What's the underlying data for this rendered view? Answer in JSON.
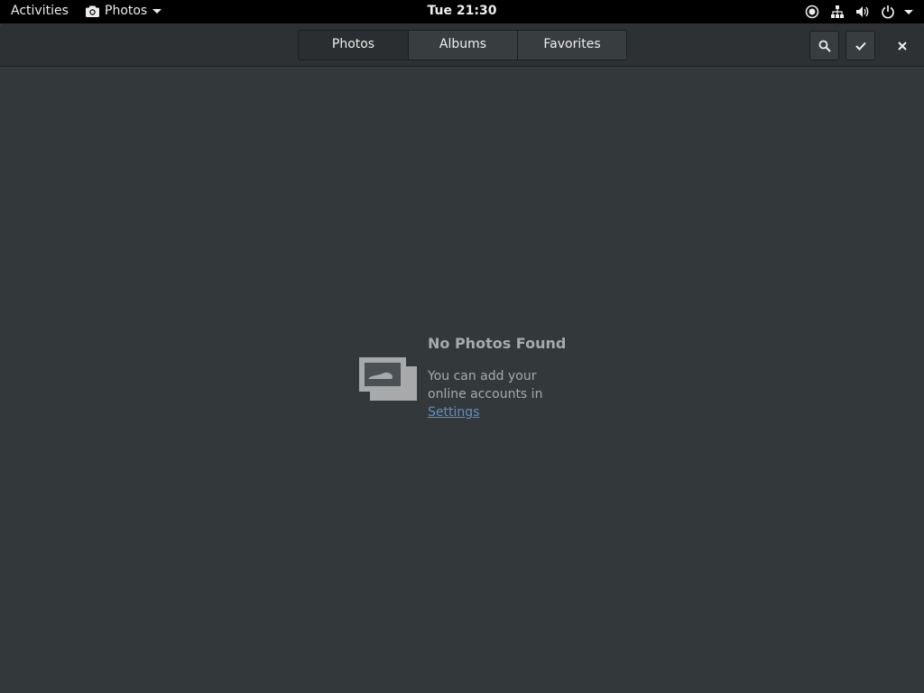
{
  "topbar": {
    "activities_label": "Activities",
    "app_name": "Photos",
    "clock": "Tue 21:30",
    "status_icons": [
      "accessibility-icon",
      "network-icon",
      "volume-icon",
      "power-icon"
    ]
  },
  "headerbar": {
    "tabs": [
      {
        "label": "Photos",
        "active": true
      },
      {
        "label": "Albums",
        "active": false
      },
      {
        "label": "Favorites",
        "active": false
      }
    ],
    "buttons": [
      "search-icon",
      "select-check-icon",
      "close-icon"
    ]
  },
  "empty_state": {
    "title": "No Photos Found",
    "message_line1": "You can add your",
    "message_line2": "online accounts in",
    "link": "Settings"
  },
  "colors": {
    "window_bg": "#33393b",
    "headerbar_bg": "#2d3133",
    "topbar_bg": "#000000",
    "link": "#5d8ec6",
    "muted_text": "#a7a9aa"
  }
}
